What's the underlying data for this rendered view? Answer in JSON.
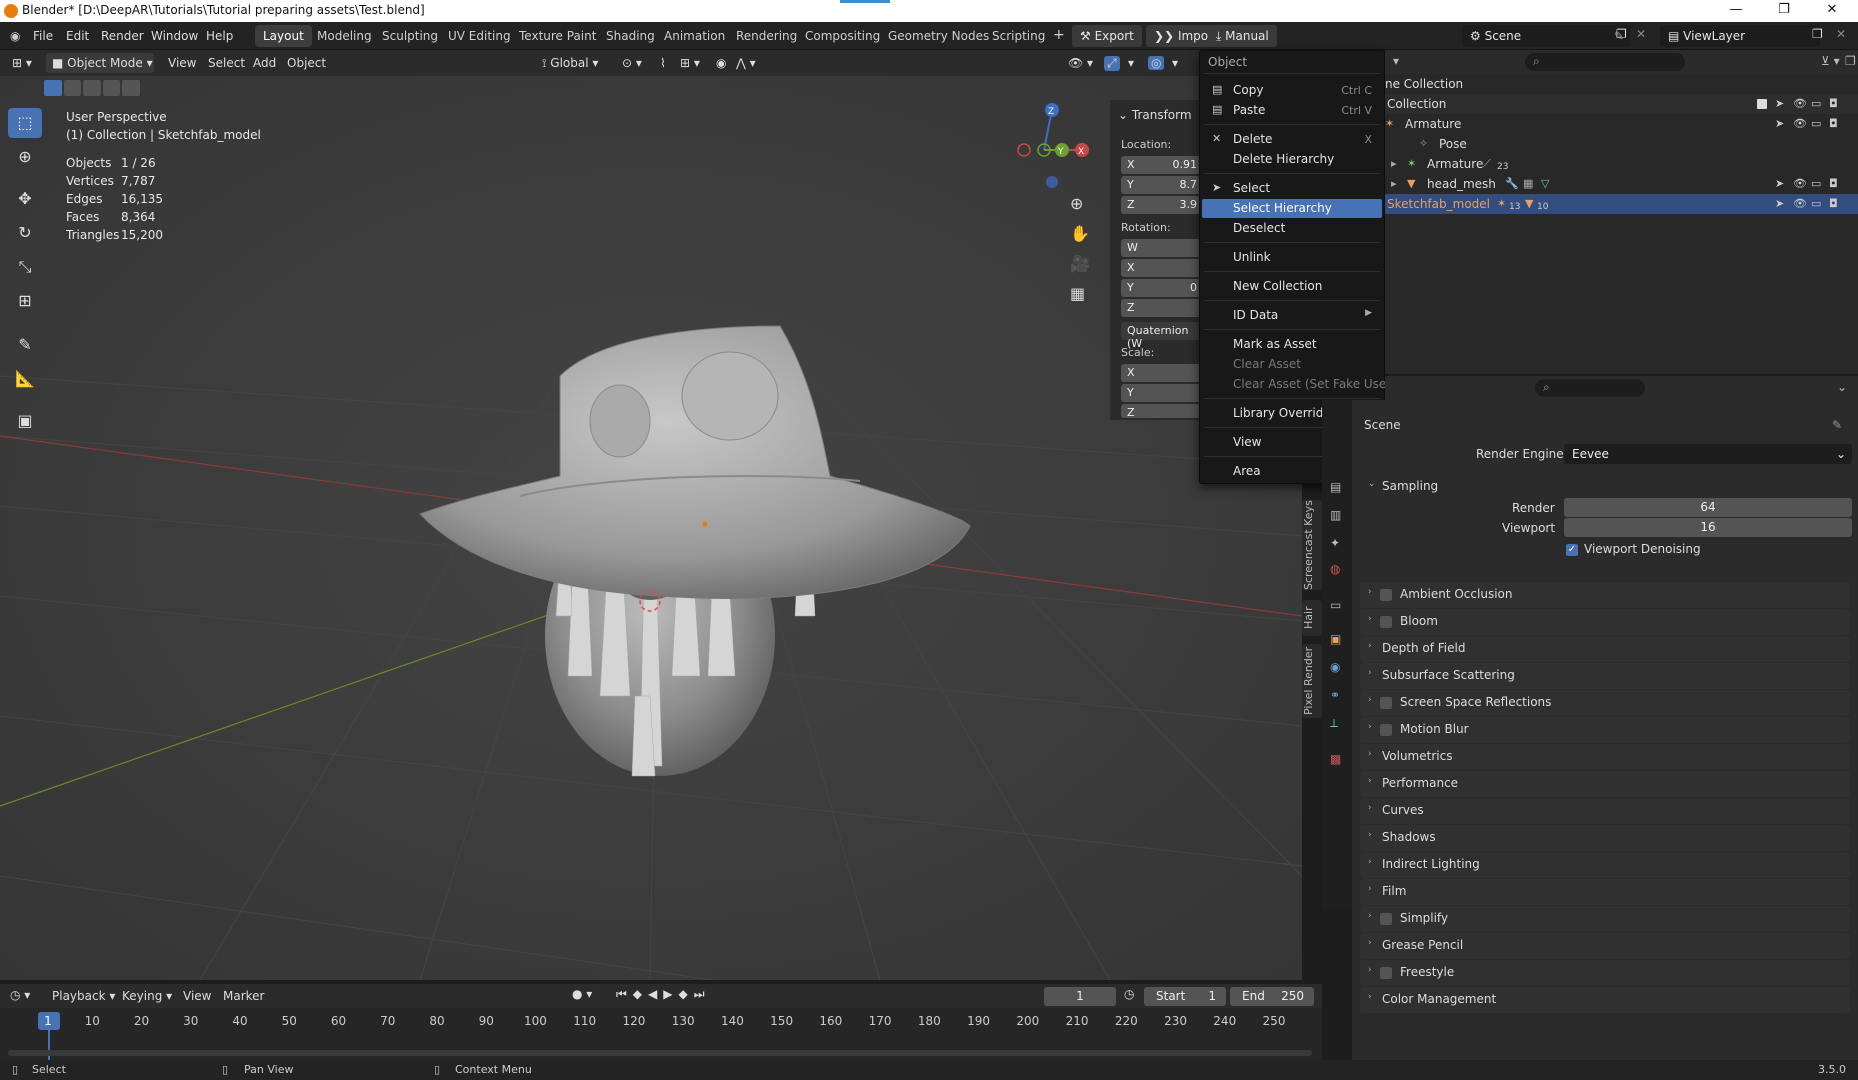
{
  "title_bar": {
    "title": "Blender* [D:\\DeepAR\\Tutorials\\Tutorial preparing assets\\Test.blend]",
    "minimize": "—",
    "maximize": "❐",
    "close": "✕"
  },
  "menubar": {
    "menus": [
      "File",
      "Edit",
      "Render",
      "Window",
      "Help"
    ],
    "workspaces": [
      "Layout",
      "Modeling",
      "Sculpting",
      "UV Editing",
      "Texture Paint",
      "Shading",
      "Animation",
      "Rendering",
      "Compositing",
      "Geometry Nodes",
      "Scripting"
    ],
    "add_tab": "+",
    "export": "Export",
    "import": "Import",
    "manual": "Manual",
    "scene": "Scene",
    "view_layer": "ViewLayer"
  },
  "viewport_header": {
    "mode": "Object Mode",
    "menus": [
      "View",
      "Select",
      "Add",
      "Object"
    ],
    "orientation": "Global"
  },
  "overlay": {
    "perspective": "User Perspective",
    "collection": "(1) Collection | Sketchfab_model",
    "stats": [
      {
        "label": "Objects",
        "value": "1 / 26"
      },
      {
        "label": "Vertices",
        "value": "7,787"
      },
      {
        "label": "Edges",
        "value": "16,135"
      },
      {
        "label": "Faces",
        "value": "8,364"
      },
      {
        "label": "Triangles",
        "value": "15,200"
      }
    ]
  },
  "gizmo": {
    "z": "Z",
    "y": "Y",
    "x": "X"
  },
  "npanel": {
    "title": "Transform",
    "location_label": "Location:",
    "loc": [
      {
        "axis": "X",
        "value": "0.91"
      },
      {
        "axis": "Y",
        "value": "8.7"
      },
      {
        "axis": "Z",
        "value": "3.9"
      }
    ],
    "rotation_label": "Rotation:",
    "rot": [
      "W",
      "X",
      "Y",
      "Z"
    ],
    "rot_y_val": "0",
    "mode": "Quaternion (W",
    "scale_label": "Scale:",
    "scale": [
      "X",
      "Y",
      "Z"
    ]
  },
  "side_tabs": [
    "Screencast Keys",
    "Hair",
    "Pixel Render"
  ],
  "context_menu": {
    "title": "Object",
    "items": [
      {
        "label": "Copy",
        "shortcut": "Ctrl C"
      },
      {
        "label": "Paste",
        "shortcut": "Ctrl V"
      },
      {
        "label": "Delete",
        "shortcut": "X"
      },
      {
        "label": "Delete Hierarchy"
      },
      {
        "label": "Select"
      },
      {
        "label": "Select Hierarchy"
      },
      {
        "label": "Deselect"
      },
      {
        "label": "Unlink"
      },
      {
        "label": "New Collection"
      },
      {
        "label": "ID Data"
      },
      {
        "label": "Mark as Asset"
      },
      {
        "label": "Clear Asset"
      },
      {
        "label": "Clear Asset (Set Fake User)"
      },
      {
        "label": "Library Override"
      },
      {
        "label": "View"
      },
      {
        "label": "Area"
      }
    ]
  },
  "outliner": {
    "rows": [
      {
        "label": "ne Collection"
      },
      {
        "label": "Collection"
      },
      {
        "label": "Armature"
      },
      {
        "label": "Pose"
      },
      {
        "label": "Armature",
        "badge": "23"
      },
      {
        "label": "head_mesh"
      },
      {
        "label": "Sketchfab_model",
        "badge1": "13",
        "badge2": "10"
      }
    ]
  },
  "properties": {
    "scene": "Scene",
    "render_engine_label": "Render Engine",
    "render_engine": "Eevee",
    "sampling": "Sampling",
    "render_label": "Render",
    "render_value": "64",
    "viewport_label": "Viewport",
    "viewport_value": "16",
    "viewport_denoising": "Viewport Denoising",
    "sections": [
      {
        "label": "Ambient Occlusion",
        "cb": true
      },
      {
        "label": "Bloom",
        "cb": true
      },
      {
        "label": "Depth of Field",
        "cb": false
      },
      {
        "label": "Subsurface Scattering",
        "cb": false
      },
      {
        "label": "Screen Space Reflections",
        "cb": true
      },
      {
        "label": "Motion Blur",
        "cb": true
      },
      {
        "label": "Volumetrics",
        "cb": false
      },
      {
        "label": "Performance",
        "cb": false
      },
      {
        "label": "Curves",
        "cb": false
      },
      {
        "label": "Shadows",
        "cb": false
      },
      {
        "label": "Indirect Lighting",
        "cb": false
      },
      {
        "label": "Film",
        "cb": false
      },
      {
        "label": "Simplify",
        "cb": true
      },
      {
        "label": "Grease Pencil",
        "cb": false
      },
      {
        "label": "Freestyle",
        "cb": true
      },
      {
        "label": "Color Management",
        "cb": false
      }
    ]
  },
  "timeline": {
    "menus": [
      "Playback",
      "Keying",
      "View",
      "Marker"
    ],
    "current_frame": "1",
    "start_label": "Start",
    "start": "1",
    "end_label": "End",
    "end": "250",
    "ticks": [
      "1",
      "10",
      "20",
      "30",
      "40",
      "50",
      "60",
      "70",
      "80",
      "90",
      "100",
      "110",
      "120",
      "130",
      "140",
      "150",
      "160",
      "170",
      "180",
      "190",
      "200",
      "210",
      "220",
      "230",
      "240",
      "250"
    ]
  },
  "status_bar": {
    "select": "Select",
    "pan_view": "Pan View",
    "context_menu": "Context Menu",
    "version": "3.5.0"
  },
  "colors": {
    "accent": "#4772b3",
    "selected_row": "#334d80",
    "orange": "#e87d0d"
  }
}
